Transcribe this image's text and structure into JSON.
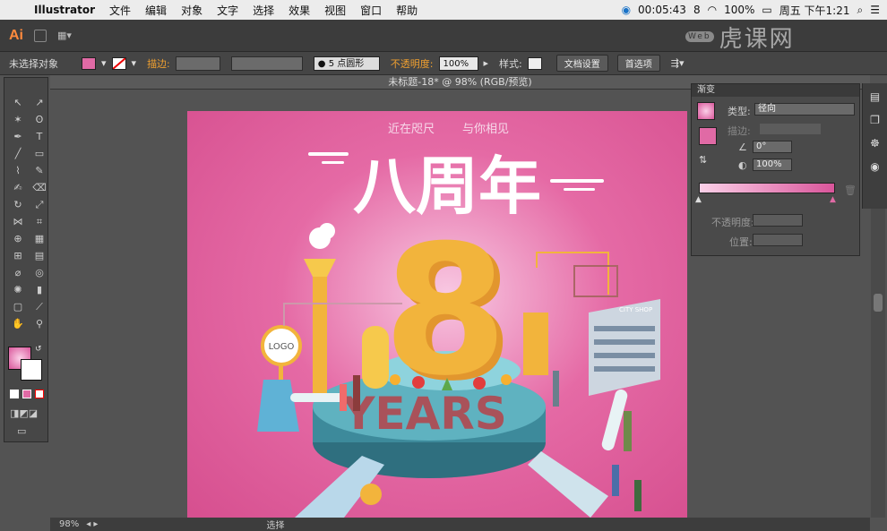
{
  "menubar": {
    "app": "Illustrator",
    "items": [
      "文件",
      "编辑",
      "对象",
      "文字",
      "选择",
      "效果",
      "视图",
      "窗口",
      "帮助"
    ],
    "timer": "00:05:43",
    "battery": "100%",
    "clock": "周五 下午1:21",
    "input_method": "8"
  },
  "appbar": {
    "logo": "Ai",
    "workspace": "Web"
  },
  "control": {
    "selection": "未选择对象",
    "stroke_label": "描边:",
    "brush": "5 点圆形",
    "opacity_label": "不透明度:",
    "opacity_value": "100%",
    "style_label": "样式:",
    "doc_setup": "文档设置",
    "prefs": "首选项"
  },
  "document": {
    "title": "未标题-18* @ 98% (RGB/预览)"
  },
  "gradient_panel": {
    "title": "渐变",
    "type_label": "类型:",
    "type_value": "径向",
    "stroke_label": "描边:",
    "angle": "0°",
    "aspect": "100%",
    "opacity_label": "不透明度:",
    "position_label": "位置:"
  },
  "artwork": {
    "tagline_left": "近在咫尺",
    "tagline_right": "与你相见",
    "headline": "八周年",
    "number": "8",
    "years": "YEARS",
    "logo": "LOGO",
    "city_shop": "CITY SHOP"
  },
  "colors": {
    "pink": "#d64f8f",
    "gold": "#f2b43c",
    "teal": "#3d8a9b"
  },
  "status": {
    "zoom": "98%",
    "tool": "选择"
  },
  "watermark": {
    "brand": "虎课网",
    "web_tag": "Web"
  }
}
